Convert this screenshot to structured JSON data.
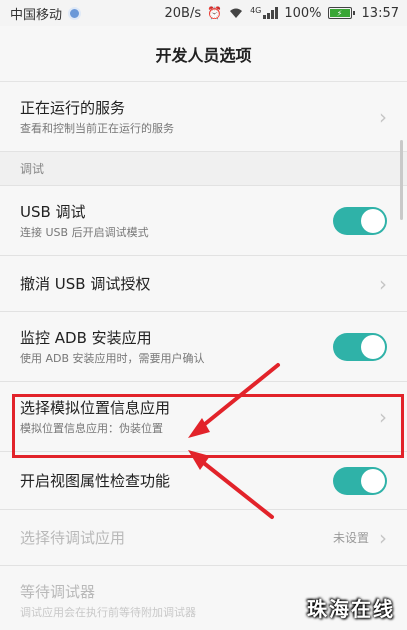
{
  "status_bar": {
    "carrier": "中国移动",
    "speed": "20B/s",
    "network": "4G",
    "battery": "100%",
    "time": "13:57"
  },
  "header": {
    "title": "开发人员选项"
  },
  "rows": {
    "running_services": {
      "title": "正在运行的服务",
      "subtitle": "查看和控制当前正在运行的服务"
    },
    "section_debug": "调试",
    "usb_debug": {
      "title": "USB 调试",
      "subtitle": "连接 USB 后开启调试模式",
      "enabled": true
    },
    "revoke_usb": {
      "title": "撤消 USB 调试授权"
    },
    "monitor_adb": {
      "title": "监控 ADB 安装应用",
      "subtitle": "使用 ADB 安装应用时，需要用户确认",
      "enabled": true
    },
    "mock_location": {
      "title": "选择模拟位置信息应用",
      "subtitle": "模拟位置信息应用：伪装位置"
    },
    "view_attr": {
      "title": "开启视图属性检查功能",
      "enabled": true
    },
    "debug_app": {
      "title": "选择待调试应用",
      "value": "未设置"
    },
    "wait_debugger": {
      "title": "等待调试器",
      "subtitle": "调试应用会在执行前等待附加调试器"
    }
  },
  "colors": {
    "toggle_on": "#2fb2a8",
    "highlight": "#e2232a"
  },
  "watermark": "珠海在线"
}
